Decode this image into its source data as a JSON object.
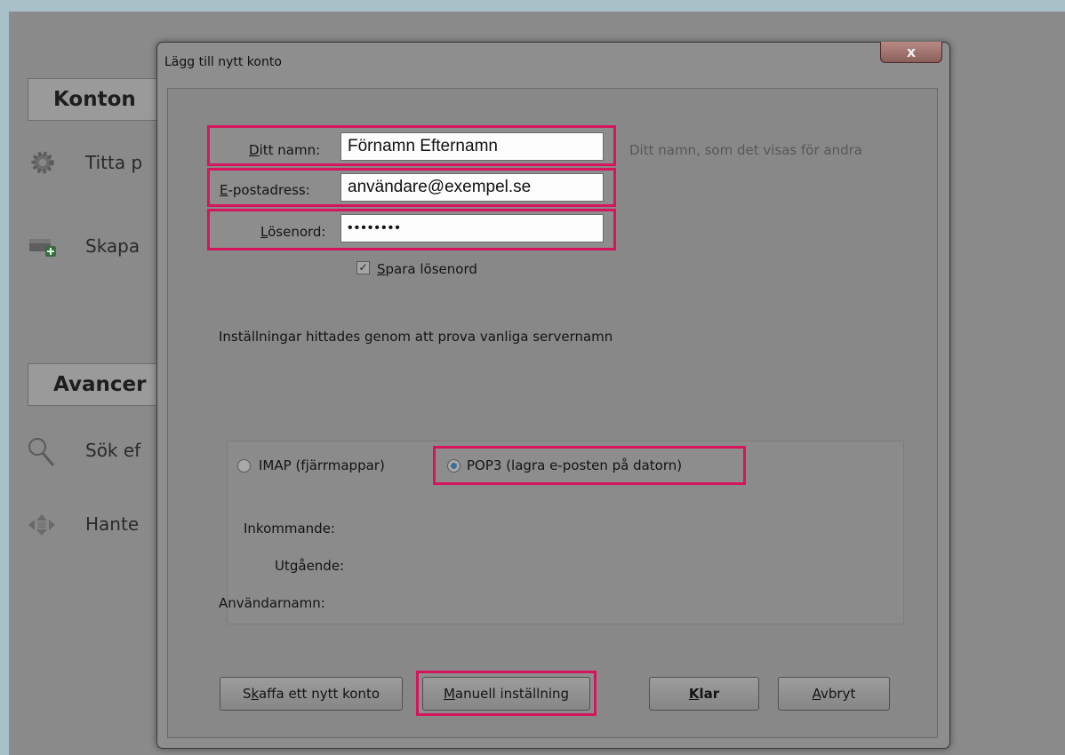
{
  "background": {
    "section1": "Konton",
    "item1": "Titta p",
    "item2": "Skapa",
    "section2": "Avancer",
    "item3": "Sök ef",
    "item4": "Hante"
  },
  "dialog": {
    "title": "Lägg till nytt konto",
    "close": "x",
    "name_label": {
      "pre": "",
      "key": "D",
      "post": "itt namn:"
    },
    "name_value": "Förnamn Efternamn",
    "name_hint": "Ditt namn, som det visas för andra",
    "email_label": {
      "pre": "",
      "key": "E",
      "post": "-postadress:"
    },
    "email_value": "användare@exempel.se",
    "password_label": {
      "pre": "",
      "key": "L",
      "post": "ösenord:"
    },
    "password_value": "••••••••",
    "save_password": {
      "pre": "",
      "key": "S",
      "post": "para lösenord",
      "checked": true
    },
    "status_text": "Inställningar hittades genom att prova vanliga servernamn",
    "imap_label": "IMAP (fjärrmappar)",
    "pop3_label": "POP3 (lagra e-posten på datorn)",
    "selected_protocol": "POP3",
    "incoming_label": "Inkommande:",
    "outgoing_label": "Utgående:",
    "username_label": "Användarnamn:",
    "buttons": {
      "new_account": {
        "pre": "S",
        "key": "k",
        "post": "affa ett nytt konto"
      },
      "manual": {
        "pre": "",
        "key": "M",
        "post": "anuell inställning"
      },
      "done": {
        "pre": "",
        "key": "K",
        "post": "lar"
      },
      "cancel": {
        "pre": "",
        "key": "A",
        "post": "vbryt"
      }
    }
  },
  "colors": {
    "highlight": "#d6155e",
    "overlay_bg": "#8a8a8a"
  }
}
